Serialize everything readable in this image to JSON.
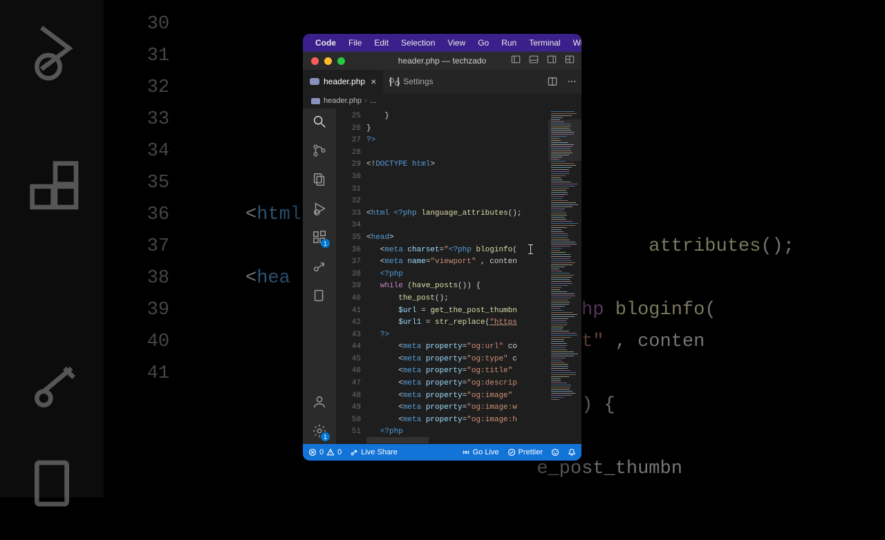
{
  "bg": {
    "line_numbers": [
      "30",
      "31",
      "32",
      "33",
      "34",
      "35",
      "36",
      "37",
      "38",
      "39",
      "40",
      "41"
    ],
    "rows": [
      {
        "segs": []
      },
      {
        "segs": []
      },
      {
        "segs": []
      },
      {
        "segs": [
          {
            "c": "d",
            "t": "<"
          },
          {
            "c": "t",
            "t": "html"
          }
        ]
      },
      {
        "segs": [
          {
            "c": "d",
            "t": "                                    "
          },
          {
            "c": "f",
            "t": "attributes"
          },
          {
            "c": "d",
            "t": "();"
          }
        ]
      },
      {
        "segs": [
          {
            "c": "d",
            "t": "<"
          },
          {
            "c": "t",
            "t": "hea"
          }
        ]
      },
      {
        "segs": [
          {
            "c": "d",
            "t": "                             "
          },
          {
            "c": "p",
            "t": "php"
          },
          {
            "c": "d",
            "t": " "
          },
          {
            "c": "f",
            "t": "bloginfo"
          },
          {
            "c": "d",
            "t": "("
          }
        ]
      },
      {
        "segs": [
          {
            "c": "d",
            "t": "                             "
          },
          {
            "c": "s",
            "t": "rt\""
          },
          {
            "c": "d",
            "t": " , conten"
          }
        ]
      },
      {
        "segs": []
      },
      {
        "segs": [
          {
            "c": "d",
            "t": "                             )) {"
          }
        ]
      },
      {
        "segs": []
      },
      {
        "segs": [
          {
            "c": "d",
            "t": "                          e_post_thumbn"
          }
        ]
      }
    ]
  },
  "menubar": [
    "Code",
    "File",
    "Edit",
    "Selection",
    "View",
    "Go",
    "Run",
    "Terminal",
    "Wi"
  ],
  "window_title": "header.php — techzado",
  "tabs": [
    {
      "label": "header.php",
      "active": true,
      "icon": "php"
    },
    {
      "label": "Settings",
      "active": false,
      "icon": "settings"
    }
  ],
  "breadcrumb": {
    "file": "header.php",
    "rest": "..."
  },
  "activity_badge_ext": "1",
  "activity_badge_gear": "1",
  "code": {
    "start": 25,
    "lines": [
      {
        "n": 25,
        "segs": [
          {
            "c": "d",
            "t": "    }"
          }
        ]
      },
      {
        "n": 26,
        "segs": [
          {
            "c": "d",
            "t": "}"
          }
        ]
      },
      {
        "n": 27,
        "segs": [
          {
            "c": "t",
            "t": "?>"
          }
        ]
      },
      {
        "n": 28,
        "segs": []
      },
      {
        "n": 29,
        "segs": [
          {
            "c": "d",
            "t": "<!"
          },
          {
            "c": "t",
            "t": "DOCTYPE"
          },
          {
            "c": "d",
            "t": " "
          },
          {
            "c": "t",
            "t": "html"
          },
          {
            "c": "d",
            "t": ">"
          }
        ]
      },
      {
        "n": 30,
        "segs": []
      },
      {
        "n": 31,
        "segs": []
      },
      {
        "n": 32,
        "segs": []
      },
      {
        "n": 33,
        "segs": [
          {
            "c": "d",
            "t": "<"
          },
          {
            "c": "t",
            "t": "html"
          },
          {
            "c": "d",
            "t": " "
          },
          {
            "c": "t",
            "t": "<?php"
          },
          {
            "c": "d",
            "t": " "
          },
          {
            "c": "f",
            "t": "language_attributes"
          },
          {
            "c": "d",
            "t": "();"
          }
        ]
      },
      {
        "n": 34,
        "segs": []
      },
      {
        "n": 35,
        "segs": [
          {
            "c": "d",
            "t": "<"
          },
          {
            "c": "t",
            "t": "head"
          },
          {
            "c": "d",
            "t": ">"
          }
        ]
      },
      {
        "n": 36,
        "segs": [
          {
            "c": "d",
            "t": "   <"
          },
          {
            "c": "t",
            "t": "meta"
          },
          {
            "c": "d",
            "t": " "
          },
          {
            "c": "a",
            "t": "charset="
          },
          {
            "c": "s",
            "t": "\""
          },
          {
            "c": "t",
            "t": "<?php"
          },
          {
            "c": "d",
            "t": " "
          },
          {
            "c": "f",
            "t": "bloginfo"
          },
          {
            "c": "d",
            "t": "("
          }
        ]
      },
      {
        "n": 37,
        "segs": [
          {
            "c": "d",
            "t": "   <"
          },
          {
            "c": "t",
            "t": "meta"
          },
          {
            "c": "d",
            "t": " "
          },
          {
            "c": "a",
            "t": "name"
          },
          {
            "c": "d",
            "t": "="
          },
          {
            "c": "s",
            "t": "\"viewport\""
          },
          {
            "c": "d",
            "t": " , conten"
          }
        ]
      },
      {
        "n": 38,
        "segs": [
          {
            "c": "d",
            "t": "   "
          },
          {
            "c": "t",
            "t": "<?php"
          }
        ]
      },
      {
        "n": 39,
        "segs": [
          {
            "c": "d",
            "t": "   "
          },
          {
            "c": "p",
            "t": "while"
          },
          {
            "c": "d",
            "t": " ("
          },
          {
            "c": "f",
            "t": "have_posts"
          },
          {
            "c": "d",
            "t": "()) {"
          }
        ]
      },
      {
        "n": 40,
        "segs": [
          {
            "c": "d",
            "t": "       "
          },
          {
            "c": "f",
            "t": "the_post"
          },
          {
            "c": "d",
            "t": "();"
          }
        ]
      },
      {
        "n": 41,
        "segs": [
          {
            "c": "d",
            "t": "       "
          },
          {
            "c": "v",
            "t": "$url"
          },
          {
            "c": "d",
            "t": " = "
          },
          {
            "c": "f",
            "t": "get_the_post_thumbn"
          }
        ]
      },
      {
        "n": 42,
        "segs": [
          {
            "c": "d",
            "t": "       "
          },
          {
            "c": "v",
            "t": "$url1"
          },
          {
            "c": "d",
            "t": " = "
          },
          {
            "c": "f",
            "t": "str_replace"
          },
          {
            "c": "d",
            "t": "("
          },
          {
            "c": "s u",
            "t": "\"https"
          }
        ]
      },
      {
        "n": 43,
        "segs": [
          {
            "c": "d",
            "t": "   "
          },
          {
            "c": "t",
            "t": "?>"
          }
        ]
      },
      {
        "n": 44,
        "segs": [
          {
            "c": "d",
            "t": "       <"
          },
          {
            "c": "t",
            "t": "meta"
          },
          {
            "c": "d",
            "t": " "
          },
          {
            "c": "a",
            "t": "property"
          },
          {
            "c": "d",
            "t": "="
          },
          {
            "c": "s",
            "t": "\"og:url\""
          },
          {
            "c": "d",
            "t": " co"
          }
        ]
      },
      {
        "n": 45,
        "segs": [
          {
            "c": "d",
            "t": "       <"
          },
          {
            "c": "t",
            "t": "meta"
          },
          {
            "c": "d",
            "t": " "
          },
          {
            "c": "a",
            "t": "property"
          },
          {
            "c": "d",
            "t": "="
          },
          {
            "c": "s",
            "t": "\"og:type\""
          },
          {
            "c": "d",
            "t": " c"
          }
        ]
      },
      {
        "n": 46,
        "segs": [
          {
            "c": "d",
            "t": "       <"
          },
          {
            "c": "t",
            "t": "meta"
          },
          {
            "c": "d",
            "t": " "
          },
          {
            "c": "a",
            "t": "property"
          },
          {
            "c": "d",
            "t": "="
          },
          {
            "c": "s",
            "t": "\"og:title\""
          }
        ]
      },
      {
        "n": 47,
        "segs": [
          {
            "c": "d",
            "t": "       <"
          },
          {
            "c": "t",
            "t": "meta"
          },
          {
            "c": "d",
            "t": " "
          },
          {
            "c": "a",
            "t": "property"
          },
          {
            "c": "d",
            "t": "="
          },
          {
            "c": "s",
            "t": "\"og:descrip"
          }
        ]
      },
      {
        "n": 48,
        "segs": [
          {
            "c": "d",
            "t": "       <"
          },
          {
            "c": "t",
            "t": "meta"
          },
          {
            "c": "d",
            "t": " "
          },
          {
            "c": "a",
            "t": "property"
          },
          {
            "c": "d",
            "t": "="
          },
          {
            "c": "s",
            "t": "\"og:image\""
          }
        ]
      },
      {
        "n": 49,
        "segs": [
          {
            "c": "d",
            "t": "       <"
          },
          {
            "c": "t",
            "t": "meta"
          },
          {
            "c": "d",
            "t": " "
          },
          {
            "c": "a",
            "t": "property"
          },
          {
            "c": "d",
            "t": "="
          },
          {
            "c": "s",
            "t": "\"og:image:w"
          }
        ]
      },
      {
        "n": 50,
        "segs": [
          {
            "c": "d",
            "t": "       <"
          },
          {
            "c": "t",
            "t": "meta"
          },
          {
            "c": "d",
            "t": " "
          },
          {
            "c": "a",
            "t": "property"
          },
          {
            "c": "d",
            "t": "="
          },
          {
            "c": "s",
            "t": "\"og:image:h"
          }
        ]
      },
      {
        "n": 51,
        "segs": [
          {
            "c": "d",
            "t": "   "
          },
          {
            "c": "t",
            "t": "<?php"
          }
        ]
      }
    ]
  },
  "status": {
    "errors": "0",
    "warnings": "0",
    "live_share": "Live Share",
    "go_live": "Go Live",
    "prettier": "Prettier"
  }
}
